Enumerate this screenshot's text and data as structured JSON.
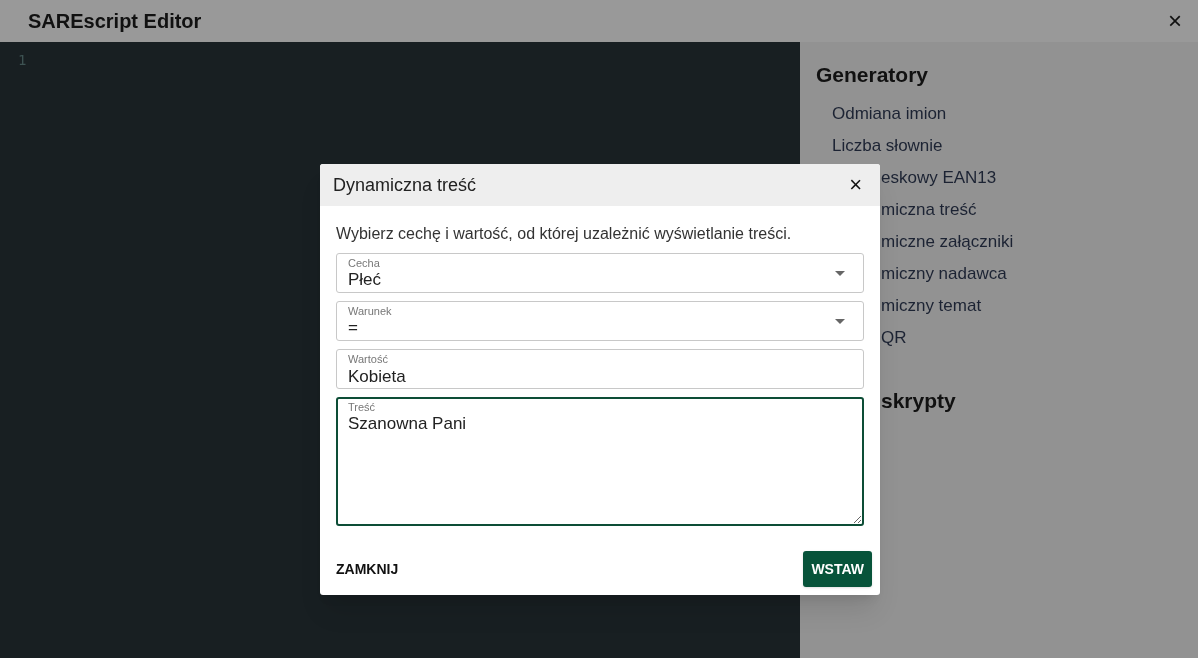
{
  "window": {
    "title": "SAREscript Editor",
    "close": "×"
  },
  "editor": {
    "line_numbers": [
      "1"
    ]
  },
  "sidebar": {
    "sections": [
      {
        "heading": "Generatory",
        "covered": false,
        "items": [
          {
            "label": "Odmiana imion",
            "covered": false
          },
          {
            "label": "Liczba słownie",
            "covered": false
          },
          {
            "label": "eskowy EAN13",
            "covered": true
          },
          {
            "label": "miczna treść",
            "covered": true
          },
          {
            "label": "miczne załączniki",
            "covered": true
          },
          {
            "label": "miczny nadawca",
            "covered": true
          },
          {
            "label": "miczny temat",
            "covered": true
          },
          {
            "label": "QR",
            "covered": true
          }
        ]
      },
      {
        "heading": "skrypty",
        "covered": true
      }
    ]
  },
  "dialog": {
    "title": "Dynamiczna treść",
    "close": "×",
    "intro": "Wybierz cechę i wartość, od której uzależnić wyświetlanie treści.",
    "fields": [
      {
        "kind": "select",
        "label": "Cecha",
        "value": "Płeć",
        "focused": false
      },
      {
        "kind": "select",
        "label": "Warunek",
        "value": "=",
        "focused": false
      },
      {
        "kind": "text",
        "label": "Wartość",
        "value": "Kobieta",
        "focused": false
      },
      {
        "kind": "textarea",
        "label": "Treść",
        "value": "Szanowna Pani",
        "focused": true
      }
    ],
    "buttons": [
      {
        "label": "ZAMKNIJ",
        "primary": false
      },
      {
        "label": "WSTAW",
        "primary": true
      }
    ]
  }
}
